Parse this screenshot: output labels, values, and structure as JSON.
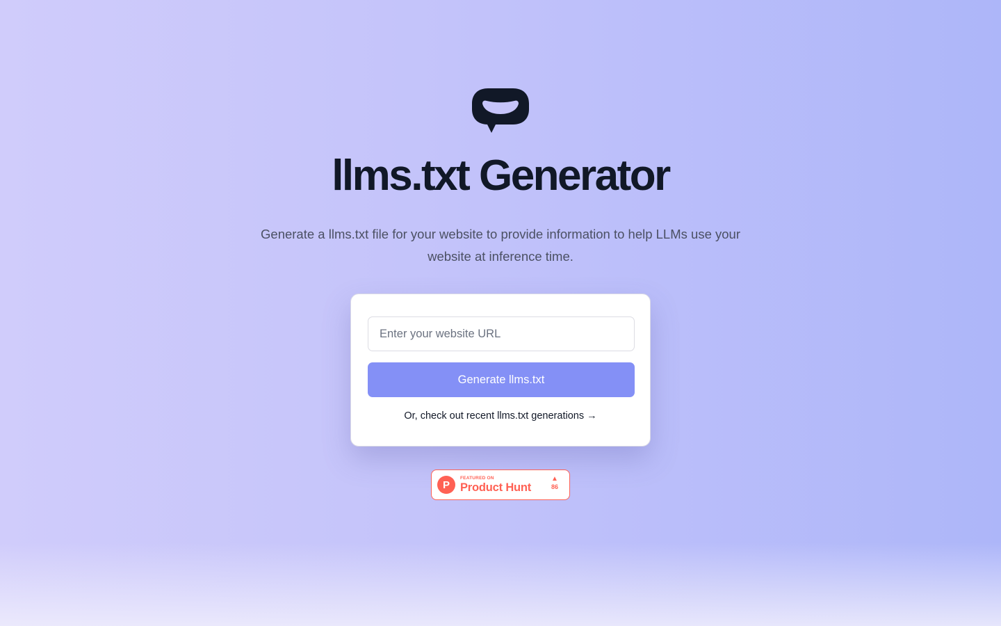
{
  "header": {
    "logo_icon": "speech-bubble-logo-icon",
    "title": "llms.txt Generator",
    "subtitle": "Generate a llms.txt file for your website to provide information to help LLMs use your website at inference time."
  },
  "form": {
    "url_placeholder": "Enter your website URL",
    "url_value": "",
    "generate_label": "Generate llms.txt",
    "recent_link_label": "Or, check out recent llms.txt generations →"
  },
  "product_hunt": {
    "featured_label": "FEATURED ON",
    "name": "Product Hunt",
    "logo_letter": "P",
    "upvote_icon": "triangle-up-icon",
    "upvote_glyph": "▲",
    "votes": "86"
  },
  "colors": {
    "background_left": "#d0ccfb",
    "background_right": "#adb6f9",
    "title": "#111827",
    "subtitle": "#4b5063",
    "button": "#8490f6",
    "product_hunt": "#ff6154"
  }
}
